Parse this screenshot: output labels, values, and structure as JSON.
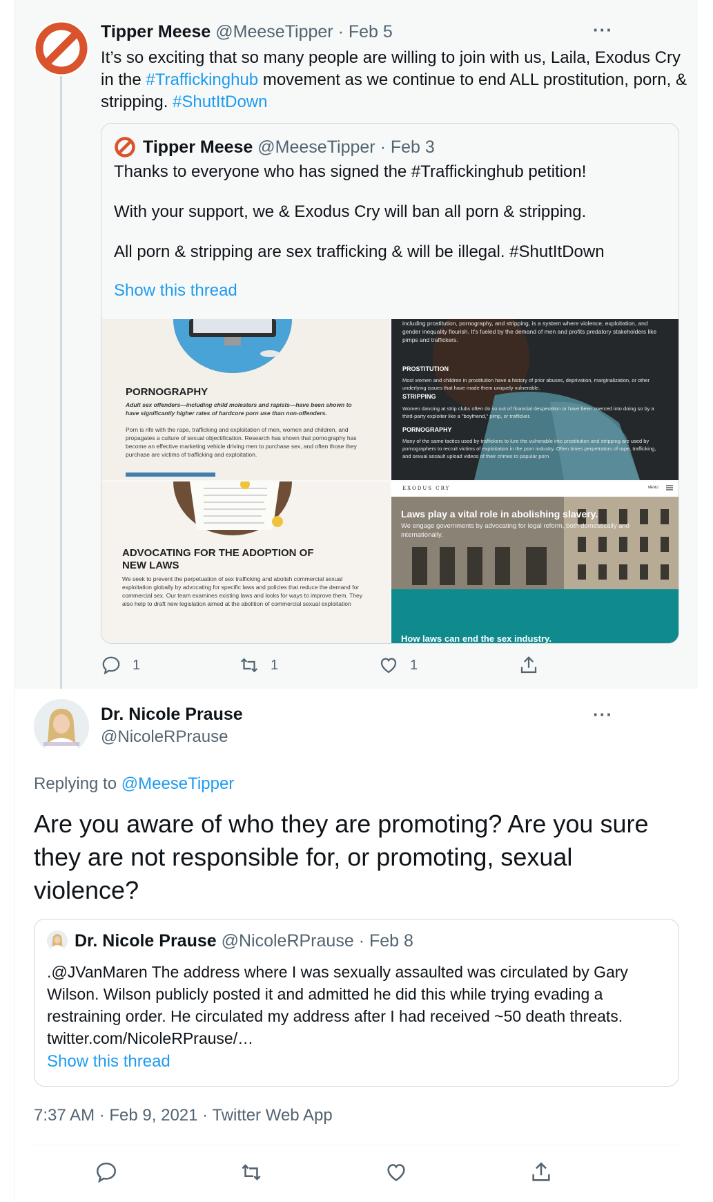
{
  "parent_tweet": {
    "author_name": "Tipper Meese",
    "author_handle": "@MeeseTipper",
    "date": "· Feb 5",
    "more": "···",
    "text_1": "It’s so exciting that so many people are willing to join with us, Laila, Exodus Cry in the ",
    "hashtag_1": "#Traffickinghub",
    "text_2": " movement as we continue to end ALL prostitution, porn, & stripping. ",
    "hashtag_2": "#ShutItDown",
    "quoted": {
      "author_name": "Tipper Meese",
      "author_handle": "@MeeseTipper",
      "date": "· Feb 3",
      "line_1": "Thanks to everyone who has signed the #Traffickinghub petition!",
      "line_2": "With your support, we & Exodus Cry will ban all porn & stripping.",
      "line_3": "All porn & stripping are sex trafficking & will be illegal. #ShutItDown",
      "show_thread": "Show this thread",
      "images": {
        "img1": {
          "heading": "PORNOGRAPHY",
          "italic": "Adult sex offenders—including child molesters and rapists—have been shown to have significantly higher rates of hardcore porn use than non-offenders.",
          "body": "Porn is rife with the rape, trafficking and exploitation of men, women and children, and propagates a culture of sexual objectification. Research has shown that pornography has become an effective marketing vehicle driving men to purchase sex, and often those they purchase are victims of trafficking and exploitation."
        },
        "img2": {
          "intro": "including prostitution, pornography, and stripping, is a system where violence, exploitation, and gender inequality flourish. It's fueled by the demand of men and profits predatory stakeholders like pimps and traffickers.",
          "h1": "PROSTITUTION",
          "t1": "Most women and children in prostitution have a history of prior abuses, deprivation, marginalization, or other underlying issues that have made them uniquely vulnerable.",
          "h2": "STRIPPING",
          "t2": "Women dancing at strip clubs often do so out of financial desperation or have been coerced into doing so by a third-party exploiter like a \"boyfriend,\" pimp, or trafficker.",
          "h3": "PORNOGRAPHY",
          "t3": "Many of the same tactics used by traffickers to lure the vulnerable into prostitution and stripping are used by pornographers to recruit victims of exploitation in the porn industry. Often times perpetrators of rape, trafficking, and sexual assault upload videos of their crimes to popular porn"
        },
        "img3": {
          "heading_1": "ADVOCATING FOR THE ADOPTION OF",
          "heading_2": "NEW LAWS",
          "body": "We seek to prevent the perpetuation of sex trafficking and abolish commercial sexual exploitation globally by advocating for specific laws and policies that reduce the demand for commercial sex. Our team examines existing laws and looks for ways to improve them. They also help to draft new legislation aimed at the abolition of commercial sexual exploitation"
        },
        "img4": {
          "logo": "EXODUS CRY",
          "menu": "MENU",
          "title": "Laws play a vital role in abolishing slavery.",
          "subtitle": "We engage governments by advocating for legal reform, both domestically and internationally.",
          "footer": "How laws can end the sex industry."
        }
      }
    },
    "actions": {
      "reply_count": "1",
      "retweet_count": "1",
      "like_count": "1"
    }
  },
  "main_tweet": {
    "author_name": "Dr. Nicole Prause",
    "author_handle": "@NicoleRPrause",
    "more": "···",
    "replying_label": "Replying to ",
    "replying_handle": "@MeeseTipper",
    "text": "Are you aware of who they are promoting? Are you sure they are not responsible for, or promoting, sexual violence?",
    "quoted": {
      "author_name": "Dr. Nicole Prause",
      "author_handle": "@NicoleRPrause",
      "date": "· Feb 8",
      "text": ".@JVanMaren The address where I was sexually assaulted was circulated by Gary Wilson. Wilson publicly posted it and admitted he did this while trying evading a restraining order. He circulated my address after I had received ~50 death threats. twitter.com/NicoleRPrause/…",
      "show_thread": "Show this thread"
    },
    "meta": "7:37 AM · Feb 9, 2021 · Twitter Web App"
  },
  "colors": {
    "link": "#1d9bf0",
    "muted": "#536471",
    "parent_bg": "#f7f9f9",
    "no_sign": "#d9532c"
  },
  "icons": [
    "no-sign-icon",
    "reply-icon",
    "retweet-icon",
    "like-icon",
    "share-icon",
    "more-icon"
  ]
}
